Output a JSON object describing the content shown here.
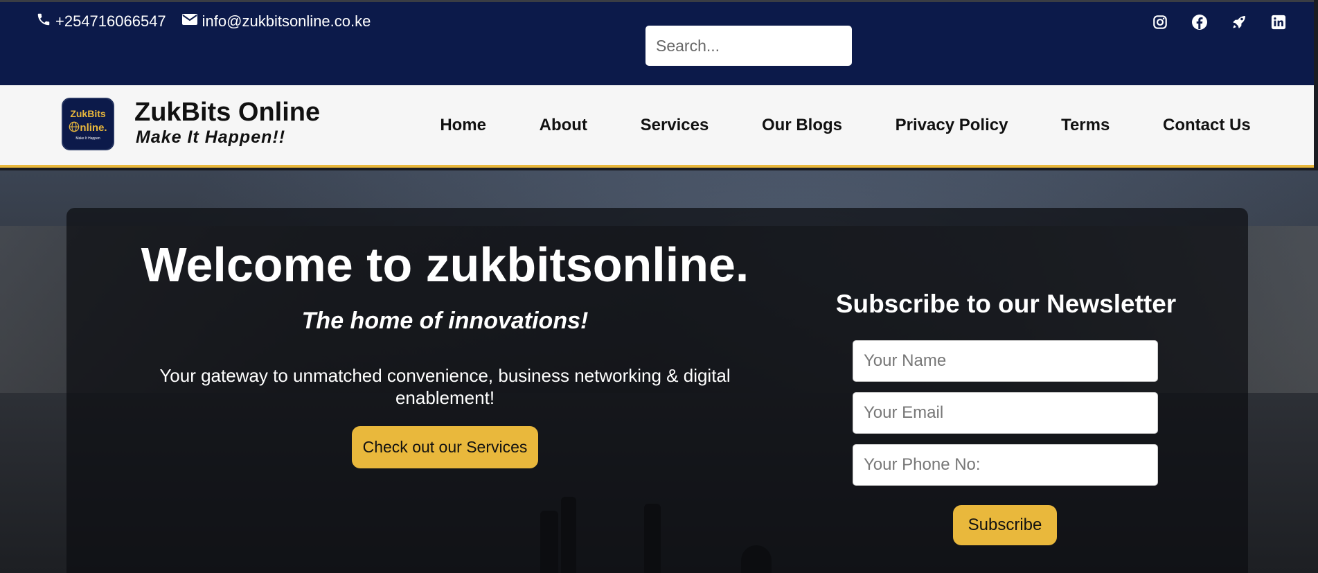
{
  "topbar": {
    "phone": "+254716066547",
    "email": "info@zukbitsonline.co.ke",
    "search_placeholder": "Search...",
    "social": [
      "instagram-icon",
      "facebook-icon",
      "rocket-icon",
      "linkedin-icon"
    ]
  },
  "brand": {
    "logo_line1": "ZukBits",
    "logo_line2": "nline.",
    "logo_line3": "Make It Happen",
    "name": "ZukBits Online",
    "tagline": "Make It Happen!!"
  },
  "nav": {
    "items": [
      "Home",
      "About",
      "Services",
      "Our Blogs",
      "Privacy Policy",
      "Terms",
      "Contact Us"
    ]
  },
  "hero": {
    "title": "Welcome to zukbitsonline.",
    "subtitle": "The home of innovations!",
    "description": "Your gateway to unmatched convenience, business networking & digital enablement!",
    "cta_label": "Check out our Services"
  },
  "newsletter": {
    "title": "Subscribe to our Newsletter",
    "name_placeholder": "Your Name",
    "email_placeholder": "Your Email",
    "phone_placeholder": "Your Phone No:",
    "submit_label": "Subscribe"
  },
  "colors": {
    "topbar_bg": "#0c1a4a",
    "accent": "#e9b83c",
    "nav_bg": "#f6f6f6"
  }
}
